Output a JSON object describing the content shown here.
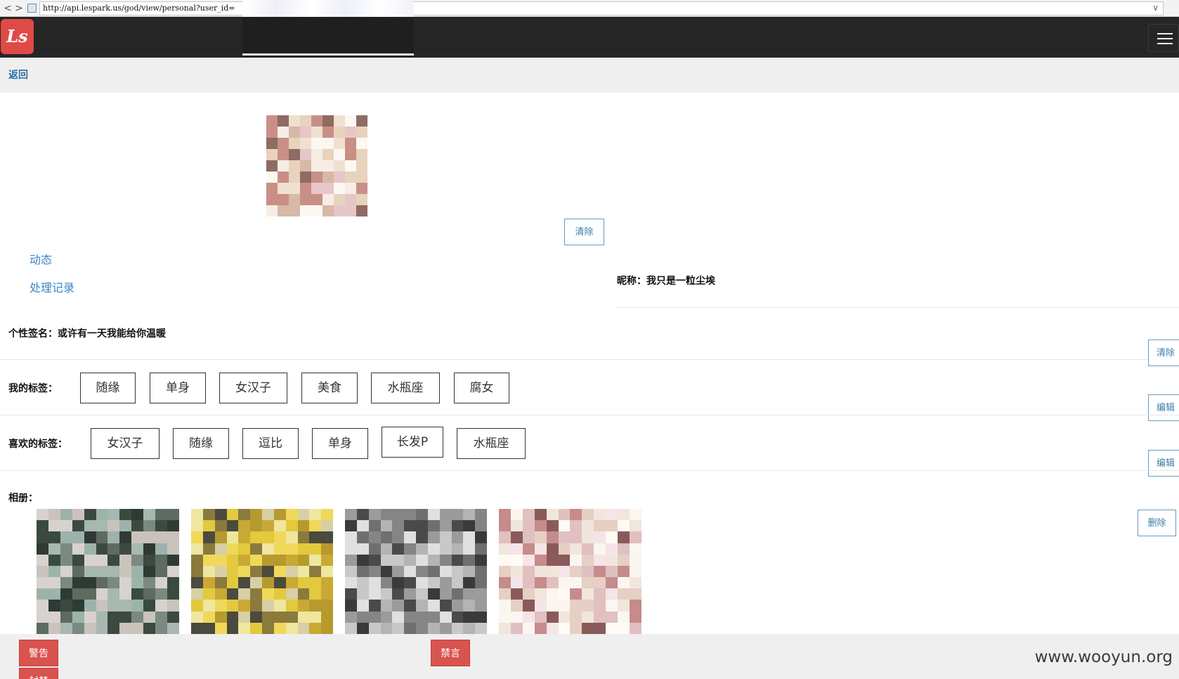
{
  "browser": {
    "back_glyph": "<",
    "forward_glyph": ">",
    "url": "http://api.lespark.us/god/view/personal?user_id=",
    "dropdown_glyph": "∨"
  },
  "header": {
    "logo_text": "Ls",
    "menu_icon": "hamburger-menu-icon"
  },
  "back_link": "返回",
  "avatar": {
    "icon": "pixelated-portrait"
  },
  "clear_avatar_label": "清除",
  "side_links": [
    "动态",
    "处理记录"
  ],
  "nickname": "昵称：我只是一粒尘埃",
  "signature": "个性签名：或许有一天我能给你温暖",
  "right_buttons": {
    "clear_signature": "清除",
    "edit_my_tags": "编辑",
    "edit_liked_tags": "编辑",
    "delete_album": "删除"
  },
  "my_tags": {
    "label": "我的标签：",
    "tags": [
      "随缘",
      "单身",
      "女汉子",
      "美食",
      "水瓶座",
      "腐女"
    ]
  },
  "liked_tags": {
    "label": "喜欢的标签：",
    "tags": [
      "女汉子",
      "随缘",
      "逗比",
      "单身",
      "长发P",
      "水瓶座"
    ]
  },
  "album": {
    "label": "相册：",
    "photos": [
      {
        "name": "album-photo-1",
        "palette": [
          "#3b4a40",
          "#7a8a80",
          "#a7b8b0",
          "#2e3a33",
          "#c9c3bc",
          "#d8d2cf",
          "#5d6b61",
          "#9cb3ac"
        ]
      },
      {
        "name": "album-photo-2",
        "palette": [
          "#c9a934",
          "#e2c93d",
          "#f0d85a",
          "#8a7a3c",
          "#4b4a3e",
          "#d7cfa5",
          "#b69a2d",
          "#efe6a0"
        ]
      },
      {
        "name": "album-photo-3",
        "palette": [
          "#6f6f6f",
          "#9b9b9b",
          "#c8c8c8",
          "#4a4a4a",
          "#e0e0e0",
          "#3a3a3a",
          "#858585",
          "#b4b4b4"
        ]
      },
      {
        "name": "album-photo-4",
        "palette": [
          "#f1e6dc",
          "#e6cfc4",
          "#fbf6f0",
          "#c68b8b",
          "#8a5a5a",
          "#f5e4e8",
          "#e0c0c0",
          "#fffaf4"
        ]
      }
    ]
  },
  "footer": {
    "warn_label": "警告",
    "ban_label": "封禁",
    "mute_label": "禁言"
  },
  "watermark": "www.wooyun.org",
  "colors": {
    "navbar": "#262626",
    "logo_red": "#e04a46",
    "link_blue": "#3a86c8",
    "danger": "#d9534f",
    "outline_btn": "#6a9bb8"
  }
}
